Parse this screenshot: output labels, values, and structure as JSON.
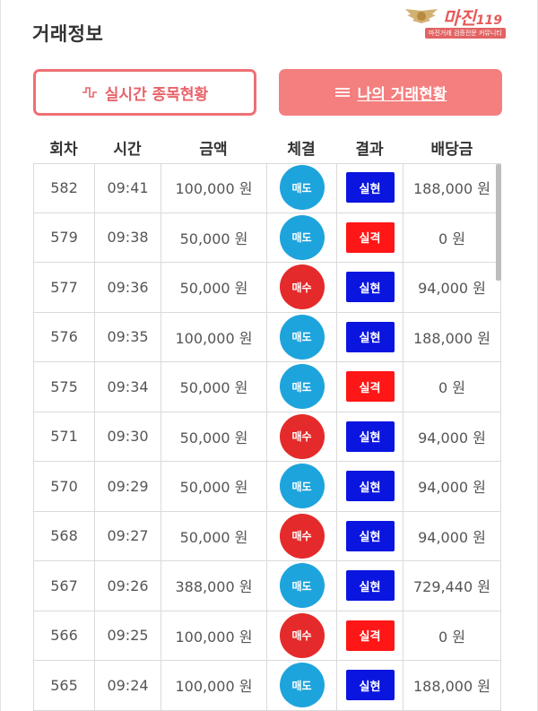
{
  "page": {
    "title": "거래정보"
  },
  "watermark": {
    "brand": "마진",
    "brand_suffix": "119",
    "tagline": "마진거래 검증전문 커뮤니티"
  },
  "buttons": {
    "live_label": "실시간 종목현황",
    "live_icon": "pulse-icon",
    "mine_label": "나의 거래현황",
    "mine_icon": "menu-lines-icon"
  },
  "table": {
    "headers": [
      "회차",
      "시간",
      "금액",
      "체결",
      "결과",
      "배당금"
    ],
    "rows": [
      {
        "round": "582",
        "time": "09:41",
        "amount": "100,000 원",
        "trade": "매도",
        "trade_type": "sell",
        "result": "실현",
        "result_type": "win",
        "payout": "188,000 원"
      },
      {
        "round": "579",
        "time": "09:38",
        "amount": "50,000 원",
        "trade": "매도",
        "trade_type": "sell",
        "result": "실격",
        "result_type": "lose",
        "payout": "0 원"
      },
      {
        "round": "577",
        "time": "09:36",
        "amount": "50,000 원",
        "trade": "매수",
        "trade_type": "buy",
        "result": "실현",
        "result_type": "win",
        "payout": "94,000 원"
      },
      {
        "round": "576",
        "time": "09:35",
        "amount": "100,000 원",
        "trade": "매도",
        "trade_type": "sell",
        "result": "실현",
        "result_type": "win",
        "payout": "188,000 원"
      },
      {
        "round": "575",
        "time": "09:34",
        "amount": "50,000 원",
        "trade": "매도",
        "trade_type": "sell",
        "result": "실격",
        "result_type": "lose",
        "payout": "0 원"
      },
      {
        "round": "571",
        "time": "09:30",
        "amount": "50,000 원",
        "trade": "매수",
        "trade_type": "buy",
        "result": "실현",
        "result_type": "win",
        "payout": "94,000 원"
      },
      {
        "round": "570",
        "time": "09:29",
        "amount": "50,000 원",
        "trade": "매도",
        "trade_type": "sell",
        "result": "실현",
        "result_type": "win",
        "payout": "94,000 원"
      },
      {
        "round": "568",
        "time": "09:27",
        "amount": "50,000 원",
        "trade": "매수",
        "trade_type": "buy",
        "result": "실현",
        "result_type": "win",
        "payout": "94,000 원"
      },
      {
        "round": "567",
        "time": "09:26",
        "amount": "388,000 원",
        "trade": "매도",
        "trade_type": "sell",
        "result": "실현",
        "result_type": "win",
        "payout": "729,440 원"
      },
      {
        "round": "566",
        "time": "09:25",
        "amount": "100,000 원",
        "trade": "매수",
        "trade_type": "buy",
        "result": "실격",
        "result_type": "lose",
        "payout": "0 원"
      },
      {
        "round": "565",
        "time": "09:24",
        "amount": "100,000 원",
        "trade": "매도",
        "trade_type": "sell",
        "result": "실현",
        "result_type": "win",
        "payout": "188,000 원"
      }
    ]
  },
  "colors": {
    "accent": "#f47f7f",
    "sell": "#1ea4dc",
    "buy": "#e42a2a",
    "win": "#0a15e0",
    "lose": "#ff1616"
  }
}
